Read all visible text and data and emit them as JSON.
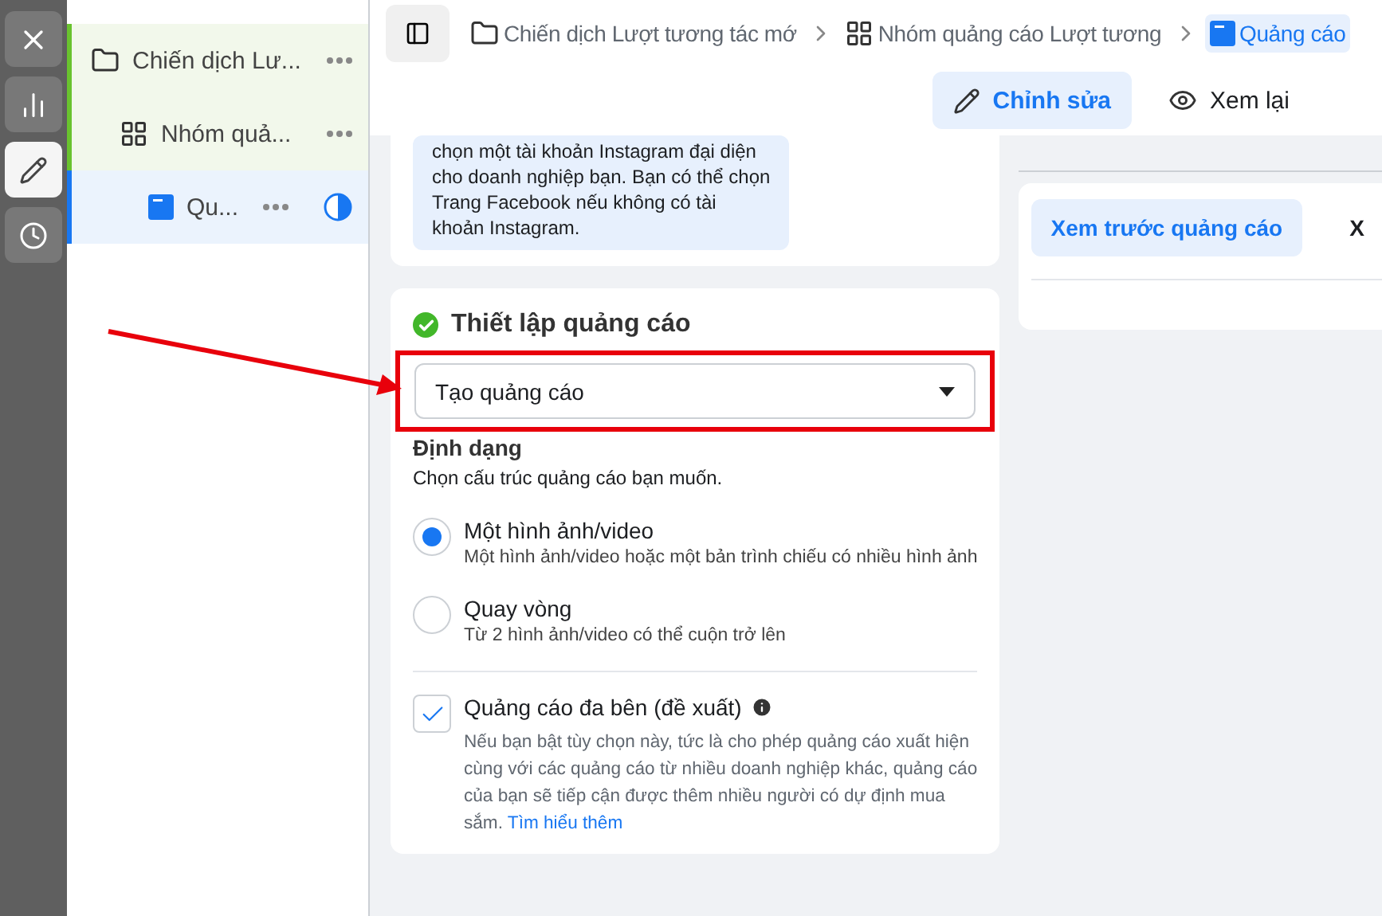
{
  "rail": [
    {
      "kind": "close",
      "selected": false
    },
    {
      "kind": "chart",
      "selected": false
    },
    {
      "kind": "edit",
      "selected": true
    },
    {
      "kind": "history",
      "selected": false
    }
  ],
  "tree": [
    {
      "kind": "campaign",
      "label": "Chiến dịch Lư...",
      "selected": false,
      "children": [
        {
          "kind": "adset",
          "label": "Nhóm quả...",
          "selected": false,
          "children": [
            {
              "kind": "ad",
              "label": "Qu...",
              "selected": true,
              "partial": true
            }
          ]
        }
      ]
    }
  ],
  "breadcrumb": [
    {
      "kind": "campaign",
      "label": "Chiến dịch Lượt tương tác mớ",
      "selected": false
    },
    {
      "kind": "adset",
      "label": "Nhóm quảng cáo Lượt tương",
      "selected": false
    },
    {
      "kind": "ad",
      "label": "Quảng cáo",
      "selected": true
    }
  ],
  "mode_buttons": [
    {
      "kind": "edit",
      "label": "Chỉnh sửa",
      "selected": true
    },
    {
      "kind": "review",
      "label": "Xem lại",
      "selected": false
    }
  ],
  "info_box": {
    "lines": [
      "chọn một tài khoản Instagram đại diện",
      "cho doanh nghiệp bạn. Bạn có thể chọn",
      "Trang Facebook nếu không có tài",
      "khoản Instagram."
    ]
  },
  "ad_setup": {
    "title": "Thiết lập quảng cáo",
    "complete": true,
    "dropdown": {
      "value": "Tạo quảng cáo"
    },
    "highlighted": true,
    "format_heading": "Định dạng",
    "format_hint": "Chọn cấu trúc quảng cáo bạn muốn.",
    "formats": [
      {
        "label": "Một hình ảnh/video",
        "description": "Một hình ảnh/video hoặc một bản trình chiếu có nhiều hình ảnh",
        "selected": true
      },
      {
        "label": "Quay vòng",
        "description": "Từ 2 hình ảnh/video có thể cuộn trở lên",
        "selected": false
      }
    ],
    "multi_advertiser": {
      "label": "Quảng cáo đa bên (đề xuất)",
      "checked": true,
      "description": "Nếu bạn bật tùy chọn này, tức là cho phép quảng cáo xuất hiện cùng với các quảng cáo từ nhiều doanh nghiệp khác, quảng cáo của bạn sẽ tiếp cận được thêm nhiều người có dự định mua sắm.",
      "link": "Tìm hiểu thêm"
    }
  },
  "preview_tabs": [
    {
      "label": "Xem trước quảng cáo",
      "selected": true
    },
    {
      "label": "X",
      "selected": false
    }
  ]
}
